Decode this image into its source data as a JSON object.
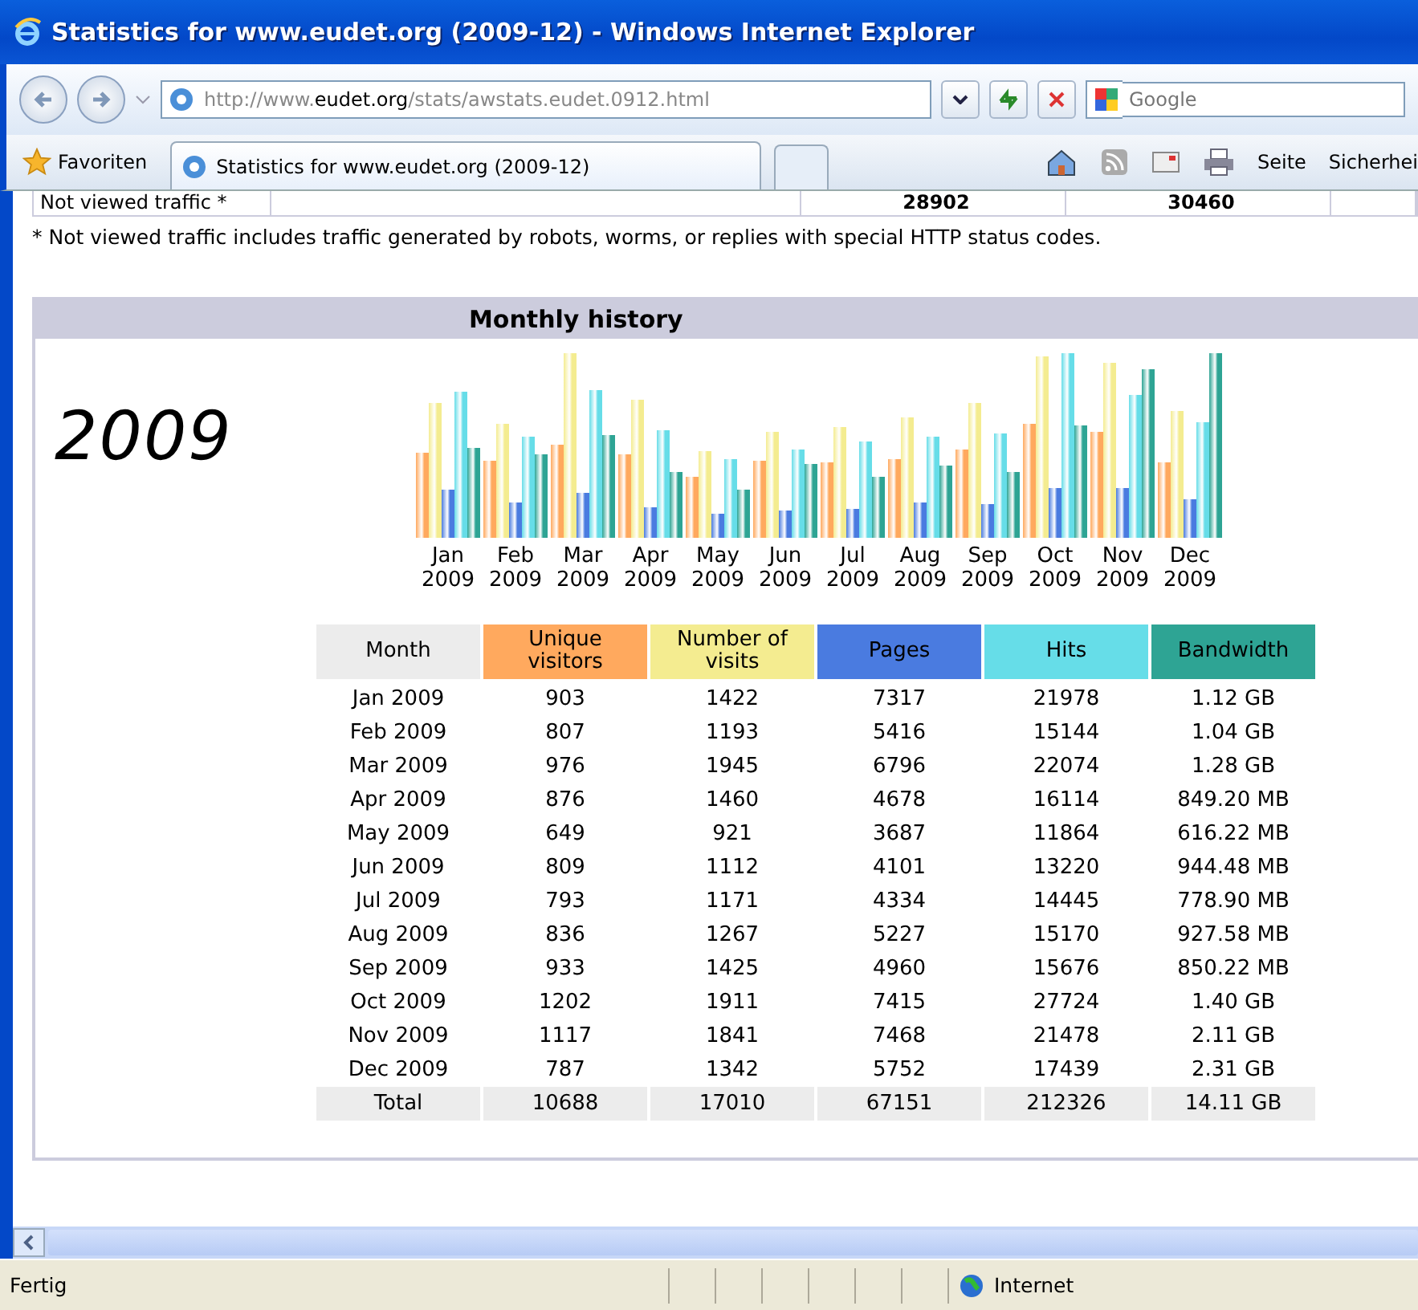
{
  "window": {
    "title": "Statistics for www.eudet.org (2009-12) - Windows Internet Explorer"
  },
  "address": {
    "prefix": "http://www.",
    "domain": "eudet.org",
    "path": "/stats/awstats.eudet.0912.html"
  },
  "search": {
    "placeholder": "Google"
  },
  "favorites_label": "Favoriten",
  "tabs": [
    {
      "label": "Statistics for www.eudet.org (2009-12)",
      "selected": true
    }
  ],
  "command_bar": [
    "Seite",
    "Sicherhei"
  ],
  "summary_row": {
    "label": "Not viewed traffic *",
    "cells": [
      "28902",
      "30460"
    ]
  },
  "footnote": "* Not viewed traffic includes traffic generated by robots, worms, or replies with special HTTP status codes.",
  "monthly_history": {
    "title": "Monthly history",
    "year": "2009",
    "chart_labels": [
      {
        "month": "Jan",
        "year": "2009"
      },
      {
        "month": "Feb",
        "year": "2009"
      },
      {
        "month": "Mar",
        "year": "2009"
      },
      {
        "month": "Apr",
        "year": "2009"
      },
      {
        "month": "May",
        "year": "2009"
      },
      {
        "month": "Jun",
        "year": "2009"
      },
      {
        "month": "Jul",
        "year": "2009"
      },
      {
        "month": "Aug",
        "year": "2009"
      },
      {
        "month": "Sep",
        "year": "2009"
      },
      {
        "month": "Oct",
        "year": "2009"
      },
      {
        "month": "Nov",
        "year": "2009"
      },
      {
        "month": "Dec",
        "year": "2009"
      }
    ],
    "columns": [
      {
        "label": "Month",
        "color": "#ececec"
      },
      {
        "label": "Unique visitors",
        "color": "#ffa95e"
      },
      {
        "label": "Number of visits",
        "color": "#f4ec90"
      },
      {
        "label": "Pages",
        "color": "#4a7be0"
      },
      {
        "label": "Hits",
        "color": "#66dde8"
      },
      {
        "label": "Bandwidth",
        "color": "#2ea494"
      }
    ],
    "rows": [
      [
        "Jan 2009",
        "903",
        "1422",
        "7317",
        "21978",
        "1.12 GB"
      ],
      [
        "Feb 2009",
        "807",
        "1193",
        "5416",
        "15144",
        "1.04 GB"
      ],
      [
        "Mar 2009",
        "976",
        "1945",
        "6796",
        "22074",
        "1.28 GB"
      ],
      [
        "Apr 2009",
        "876",
        "1460",
        "4678",
        "16114",
        "849.20 MB"
      ],
      [
        "May 2009",
        "649",
        "921",
        "3687",
        "11864",
        "616.22 MB"
      ],
      [
        "Jun 2009",
        "809",
        "1112",
        "4101",
        "13220",
        "944.48 MB"
      ],
      [
        "Jul 2009",
        "793",
        "1171",
        "4334",
        "14445",
        "778.90 MB"
      ],
      [
        "Aug 2009",
        "836",
        "1267",
        "5227",
        "15170",
        "927.58 MB"
      ],
      [
        "Sep 2009",
        "933",
        "1425",
        "4960",
        "15676",
        "850.22 MB"
      ],
      [
        "Oct 2009",
        "1202",
        "1911",
        "7415",
        "27724",
        "1.40 GB"
      ],
      [
        "Nov 2009",
        "1117",
        "1841",
        "7468",
        "21478",
        "2.11 GB"
      ],
      [
        "Dec 2009",
        "787",
        "1342",
        "5752",
        "17439",
        "2.31 GB"
      ]
    ],
    "total": [
      "Total",
      "10688",
      "17010",
      "67151",
      "212326",
      "14.11 GB"
    ]
  },
  "status_bar": {
    "text": "Fertig",
    "zone": "Internet"
  }
}
